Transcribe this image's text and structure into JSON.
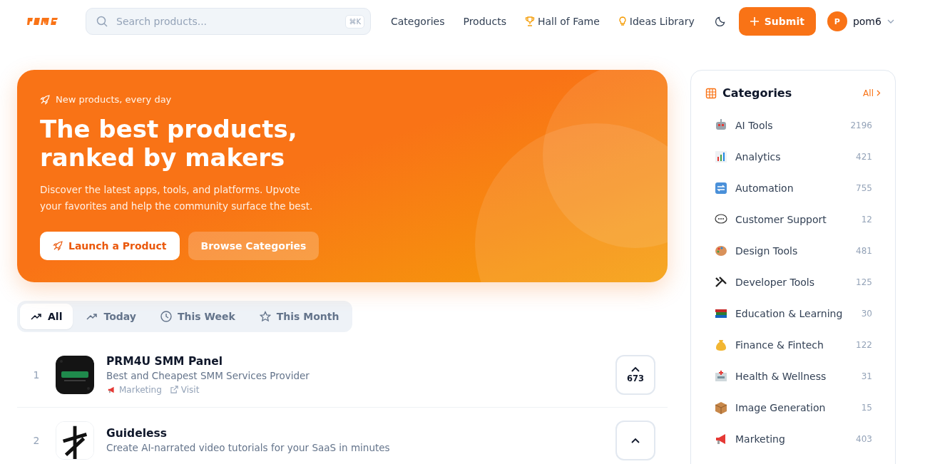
{
  "nav": {
    "search_placeholder": "Search products...",
    "shortcut": "⌘K",
    "links": [
      {
        "label": "Categories",
        "kind": "plain"
      },
      {
        "label": "Products",
        "kind": "plain"
      },
      {
        "label": "Hall of Fame",
        "kind": "trophy"
      },
      {
        "label": "Ideas Library",
        "kind": "bulb"
      }
    ],
    "submit": "Submit",
    "avatar": "P",
    "user": "pom6"
  },
  "hero": {
    "eyebrow": "New products, every day",
    "title_lines": [
      "The best products,",
      "ranked by makers"
    ],
    "subtitle": "Discover the latest apps, tools, and platforms. Upvote your favorites and help the community surface the best.",
    "primary": "Launch a Product",
    "secondary": "Browse Categories"
  },
  "tabs": [
    {
      "label": "All",
      "kind": "trend",
      "selected": true
    },
    {
      "label": "Today",
      "kind": "trend",
      "selected": false
    },
    {
      "label": "This Week",
      "kind": "clock",
      "selected": false
    },
    {
      "label": "This Month",
      "kind": "star",
      "selected": false
    }
  ],
  "products": [
    {
      "rank": "1",
      "name": "PRM4U SMM Panel",
      "tagline": "Best and Cheapest SMM Services Provider",
      "category": "Marketing",
      "link": "Visit",
      "votes": "673"
    },
    {
      "rank": "2",
      "name": "Guideless",
      "tagline": "Create AI-narrated video tutorials for your SaaS in minutes"
    }
  ],
  "sidebar": {
    "title": "Categories",
    "all": "All",
    "items": [
      {
        "name": "AI Tools",
        "count": "2196"
      },
      {
        "name": "Analytics",
        "count": "421"
      },
      {
        "name": "Automation",
        "count": "755"
      },
      {
        "name": "Customer Support",
        "count": "12"
      },
      {
        "name": "Design Tools",
        "count": "481"
      },
      {
        "name": "Developer Tools",
        "count": "125"
      },
      {
        "name": "Education & Learning",
        "count": "30"
      },
      {
        "name": "Finance & Fintech",
        "count": "122"
      },
      {
        "name": "Health & Wellness",
        "count": "31"
      },
      {
        "name": "Image Generation",
        "count": "15"
      },
      {
        "name": "Marketing",
        "count": "403"
      }
    ]
  }
}
